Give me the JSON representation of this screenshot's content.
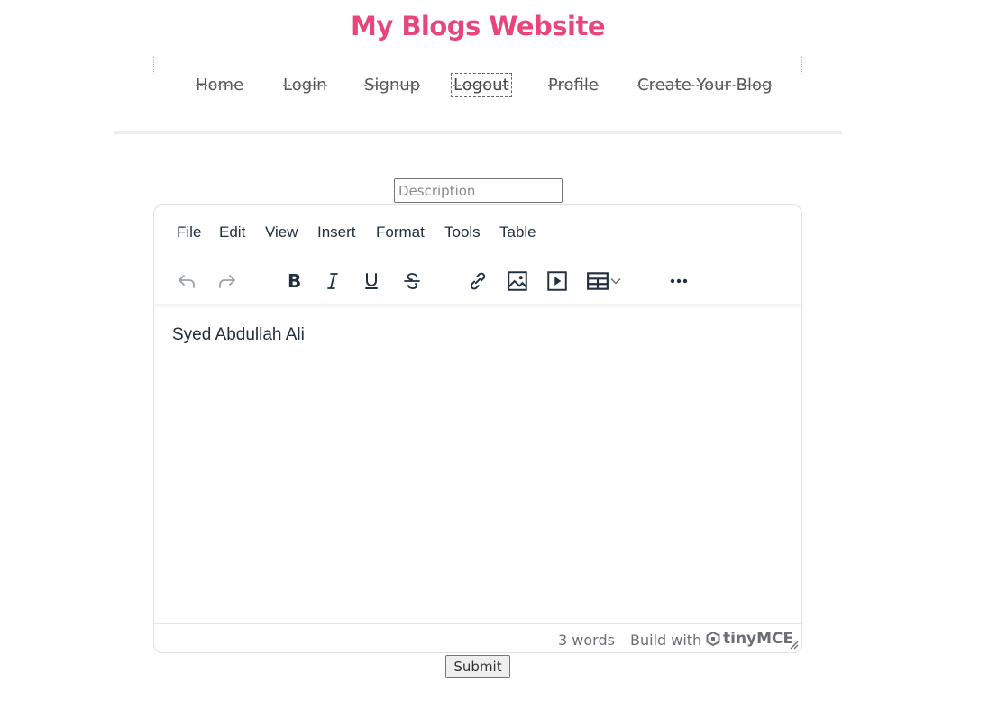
{
  "header": {
    "site_title": "My Blogs Website",
    "title_color": "#e8457a"
  },
  "nav": {
    "items": [
      {
        "label": "Home"
      },
      {
        "label": "Login"
      },
      {
        "label": "Signup"
      },
      {
        "label": "Logout"
      },
      {
        "label": "Profile"
      },
      {
        "label": "Create Your Blog"
      }
    ]
  },
  "form": {
    "description_placeholder": "Description",
    "submit_label": "Submit"
  },
  "editor": {
    "menu": [
      "File",
      "Edit",
      "View",
      "Insert",
      "Format",
      "Tools",
      "Table"
    ],
    "toolbar_icons": [
      "undo-icon",
      "redo-icon",
      "bold-icon",
      "italic-icon",
      "underline-icon",
      "strikethrough-icon",
      "link-icon",
      "image-icon",
      "media-icon",
      "table-icon",
      "more-icon"
    ],
    "content_text": "Syed Abdullah Ali",
    "word_count": "3 words",
    "build_with": "Build with",
    "brand": "tinyMCE"
  }
}
